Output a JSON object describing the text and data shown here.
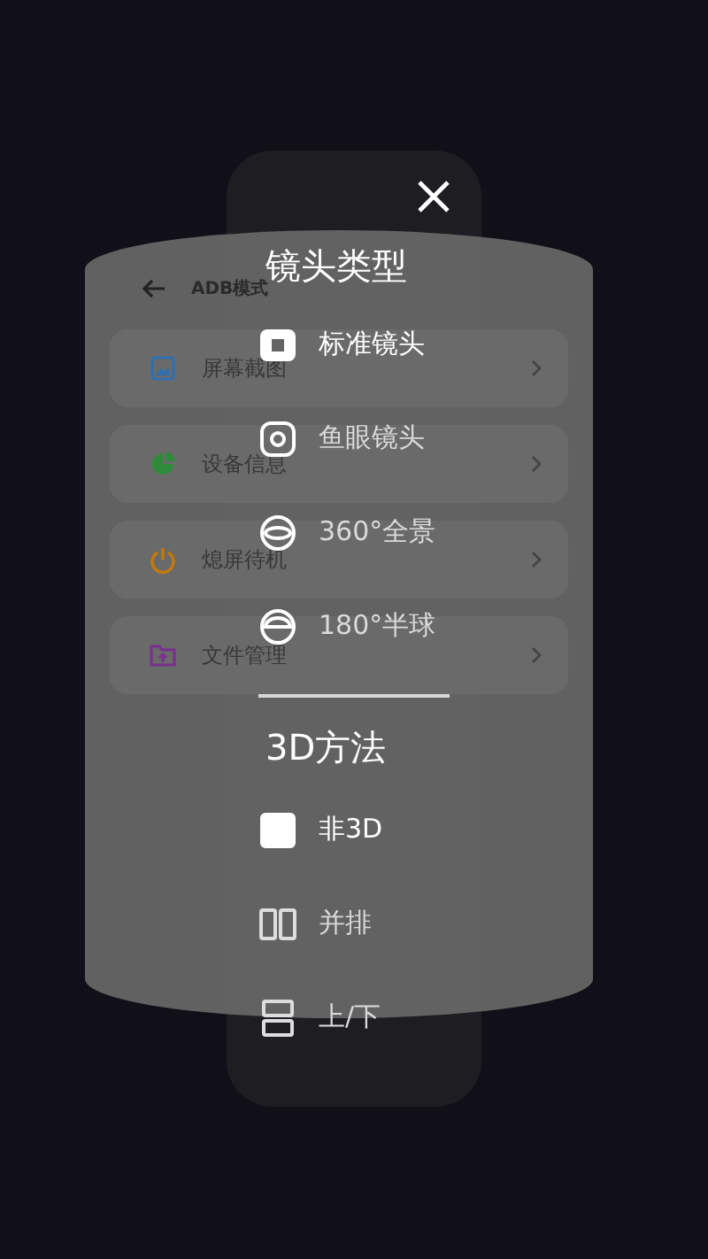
{
  "background_app": {
    "title": "ADB模式",
    "items": [
      {
        "label": "屏幕截图",
        "color": "#2f6fb0"
      },
      {
        "label": "设备信息",
        "color": "#2e8b3a"
      },
      {
        "label": "熄屏待机",
        "color": "#c07a10"
      },
      {
        "label": "文件管理",
        "color": "#7a2f8f"
      }
    ]
  },
  "menu": {
    "lens_title": "镜头类型",
    "lens_options": [
      {
        "label": "标准镜头",
        "selected": true
      },
      {
        "label": "鱼眼镜头",
        "selected": false
      },
      {
        "label": "360°全景",
        "selected": false
      },
      {
        "label": "180°半球",
        "selected": false
      }
    ],
    "method_title": "3D方法",
    "method_options": [
      {
        "label": "非3D",
        "selected": true
      },
      {
        "label": "并排",
        "selected": false
      },
      {
        "label": "上/下",
        "selected": false
      }
    ]
  }
}
